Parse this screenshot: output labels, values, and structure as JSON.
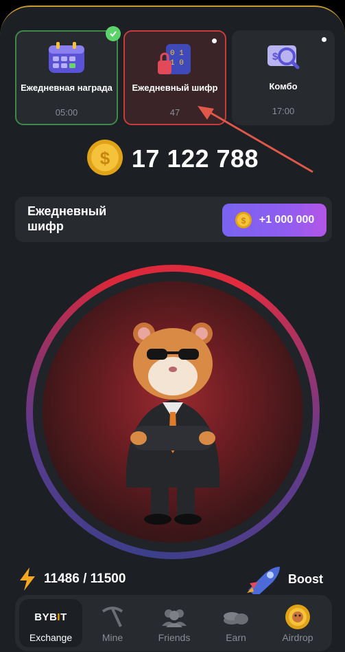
{
  "daily_cards": [
    {
      "title": "Ежедневная награда",
      "subtitle": "05:00",
      "icon": "calendar-icon",
      "state": "completed"
    },
    {
      "title": "Ежедневный шифр",
      "subtitle": "47",
      "icon": "cipher-lock-icon",
      "state": "selected"
    },
    {
      "title": "Комбо",
      "subtitle": "17:00",
      "icon": "combo-magnifier-icon",
      "state": "available"
    }
  ],
  "balance": {
    "value": "17 122 788",
    "icon": "coin-icon"
  },
  "cipher": {
    "title": "Ежедневный шифр",
    "reward": "+1 000 000"
  },
  "energy": {
    "value": "11486 / 11500",
    "icon": "lightning-icon"
  },
  "boost": {
    "label": "Boost",
    "icon": "rocket-icon"
  },
  "nav": [
    {
      "label": "Exchange",
      "icon": "bybit-logo",
      "logo_text": "BYB",
      "logo_accent": "I",
      "logo_tail": "T",
      "active": true
    },
    {
      "label": "Mine",
      "icon": "pickaxe-icon",
      "active": false
    },
    {
      "label": "Friends",
      "icon": "friends-icon",
      "active": false
    },
    {
      "label": "Earn",
      "icon": "coins-stack-icon",
      "active": false
    },
    {
      "label": "Airdrop",
      "icon": "airdrop-coin-icon",
      "active": false
    }
  ],
  "colors": {
    "background": "#1c1f24",
    "card": "#272a2f",
    "accent_gold": "#f5c33b",
    "reward_purple": "#8f5df0",
    "ring_red": "#e22c3e",
    "arrow_red": "#e0584a"
  }
}
